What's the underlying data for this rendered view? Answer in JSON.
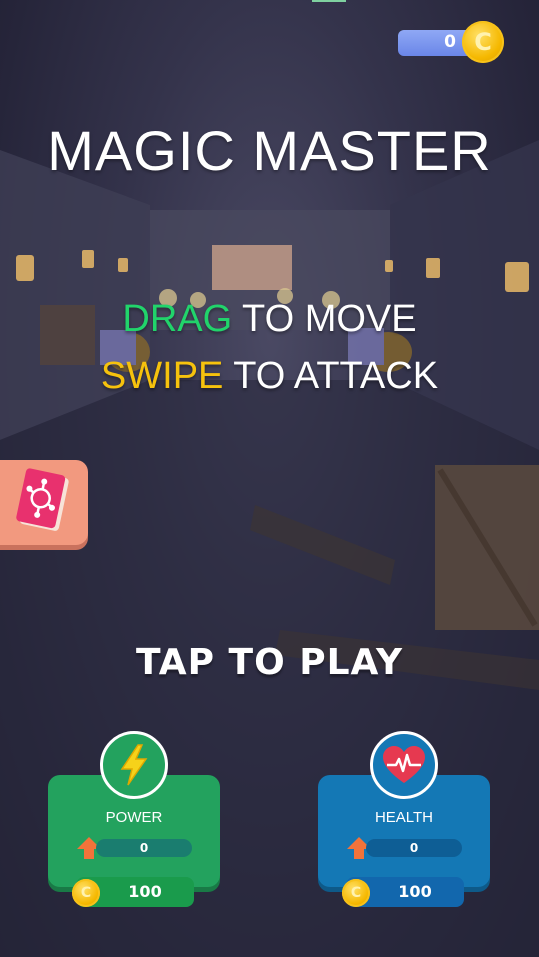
{
  "hud": {
    "coins": "0",
    "coin_symbol": "C"
  },
  "title": "MAGIC MASTER",
  "instructions": {
    "line1_accent": "DRAG",
    "line1_rest": " TO MOVE",
    "line2_accent": "SWIPE",
    "line2_rest": " TO ATTACK"
  },
  "tap_to_play": "TAP TO PLAY",
  "spellbook_button": {
    "icon": "spellbook-icon"
  },
  "upgrades": {
    "power": {
      "label": "POWER",
      "level": "0",
      "price": "100",
      "icon": "lightning-icon",
      "color": "#23a25e"
    },
    "health": {
      "label": "HEALTH",
      "level": "0",
      "price": "100",
      "icon": "heart-icon",
      "color": "#1478b5"
    }
  },
  "colors": {
    "drag": "#21d46b",
    "swipe": "#f6c20d",
    "coin": "#f5b800"
  }
}
